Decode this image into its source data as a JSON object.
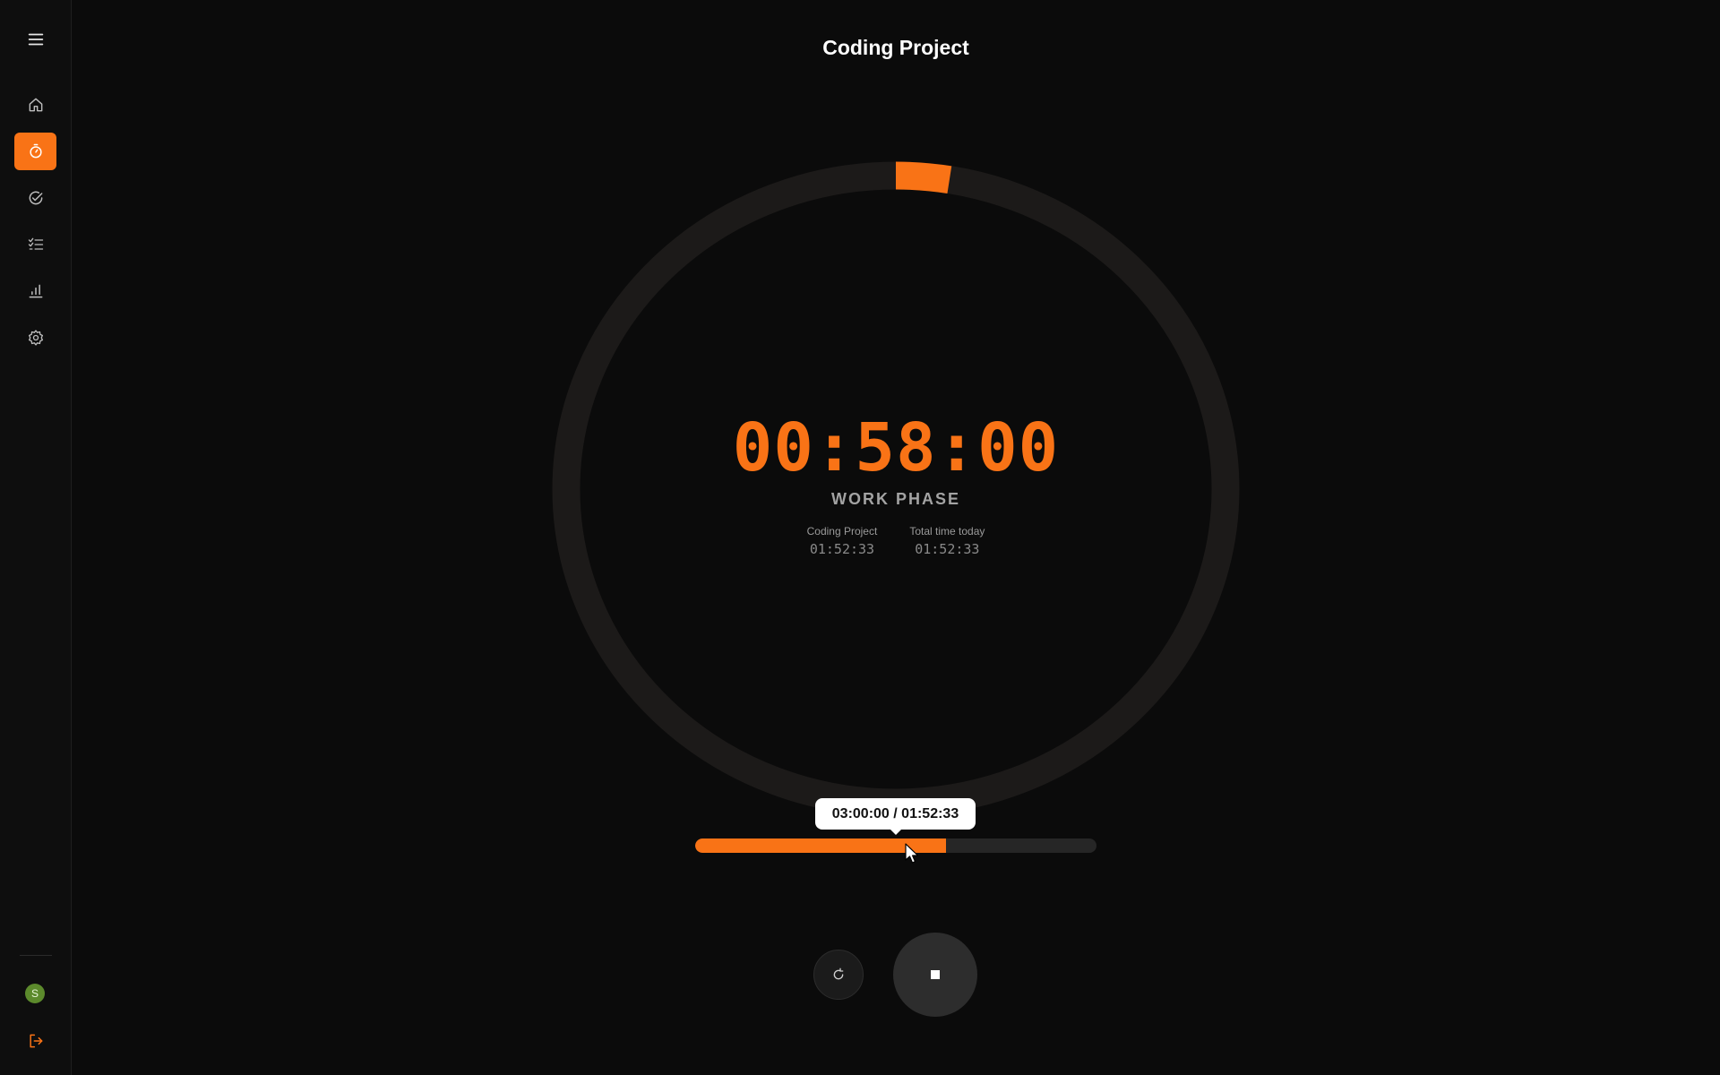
{
  "sidebar": {
    "menu_icon": "hamburger-menu-icon",
    "items": [
      {
        "icon": "home-icon"
      },
      {
        "icon": "timer-icon",
        "active": true
      },
      {
        "icon": "check-circle-icon"
      },
      {
        "icon": "checklist-icon"
      },
      {
        "icon": "bar-chart-icon"
      },
      {
        "icon": "gear-icon"
      }
    ],
    "avatar_initial": "S",
    "logout_icon": "logout-icon"
  },
  "header": {
    "title": "Coding Project"
  },
  "timer": {
    "display": "00:58:00",
    "phase": "WORK PHASE",
    "ring_progress": 0.026,
    "stats": [
      {
        "label": "Coding Project",
        "value": "01:52:33"
      },
      {
        "label": "Total time today",
        "value": "01:52:33"
      }
    ]
  },
  "progress": {
    "tooltip": "03:00:00 / 01:52:33",
    "fraction": 0.625
  },
  "controls": {
    "reset_icon": "reset-icon",
    "stop_icon": "stop-icon"
  },
  "colors": {
    "accent": "#f97316",
    "background": "#0b0b0b",
    "ring_track": "#1c1a19"
  }
}
